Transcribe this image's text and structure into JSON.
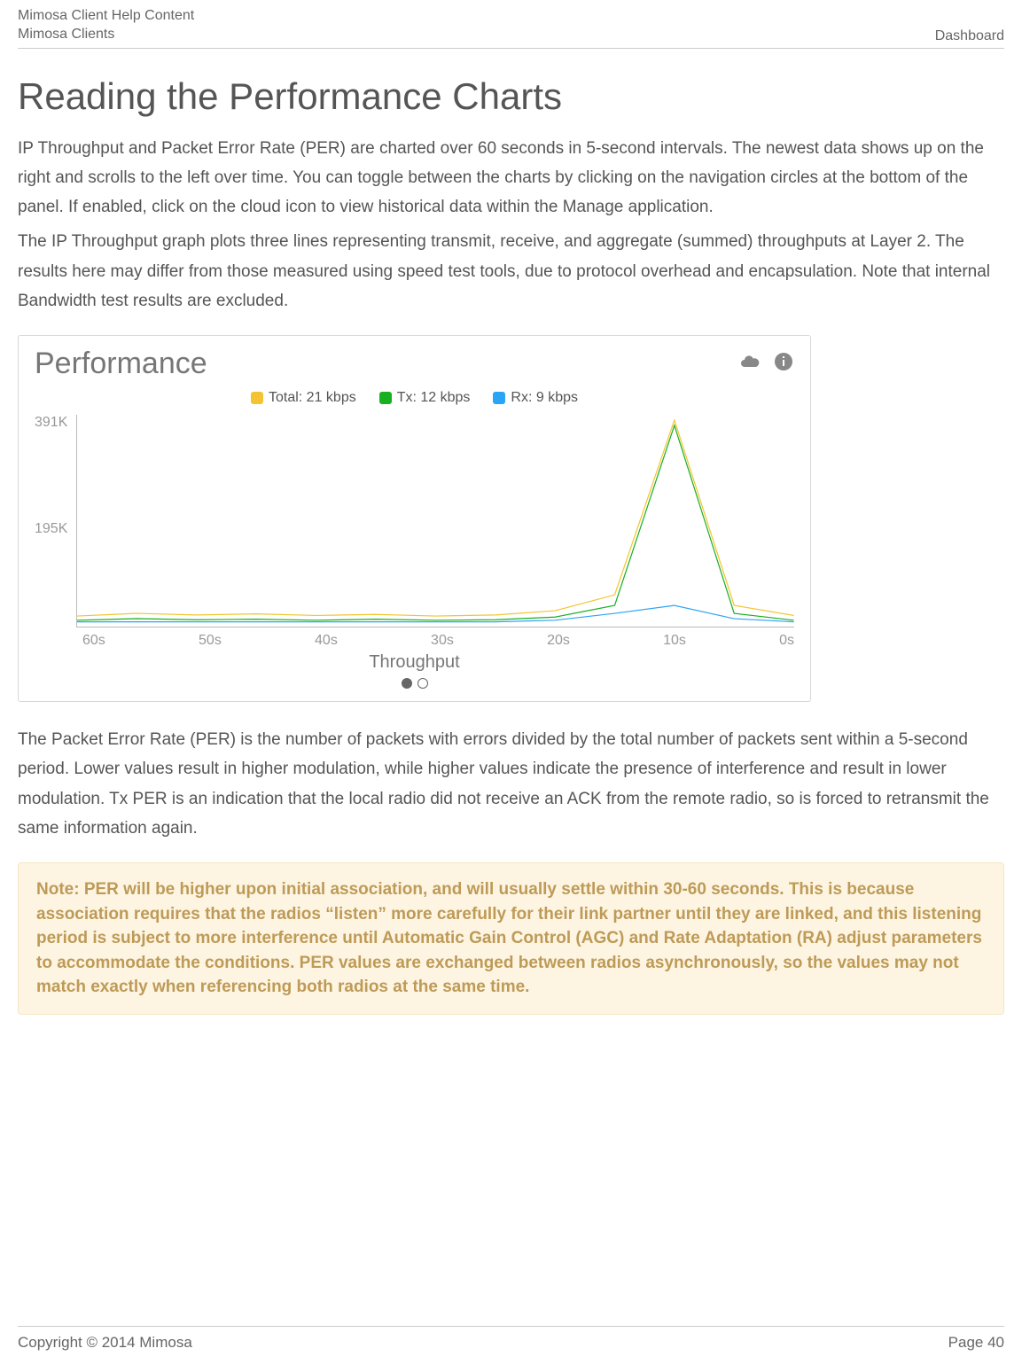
{
  "header": {
    "left_line1": "Mimosa Client Help Content",
    "left_line2": "Mimosa Clients",
    "right": "Dashboard"
  },
  "title": "Reading the Performance Charts",
  "para1": "IP Throughput and Packet Error Rate (PER) are charted over 60 seconds in 5-second intervals. The newest data shows up on the right and scrolls to the left over time. You can toggle between the charts by clicking on the navigation circles at the bottom of the panel. If enabled, click on the cloud icon to view historical data within the Manage application.",
  "para2": "The IP Throughput graph plots three lines representing transmit, receive, and aggregate (summed) throughputs at Layer 2. The results here may differ from those measured using speed test tools, due to protocol overhead and encapsulation. Note that internal Bandwidth test results are excluded.",
  "panel": {
    "title": "Performance",
    "legend": {
      "total": "Total: 21 kbps",
      "tx": "Tx: 12 kbps",
      "rx": "Rx: 9 kbps"
    },
    "colors": {
      "total": "#f4c430",
      "tx": "#17b01e",
      "rx": "#2aa4f4"
    },
    "y_ticks": [
      "391K",
      "195K"
    ],
    "x_ticks": [
      "60s",
      "50s",
      "40s",
      "30s",
      "20s",
      "10s",
      "0s"
    ],
    "x_title": "Throughput"
  },
  "chart_data": {
    "type": "line",
    "title": "Performance",
    "xlabel": "Throughput",
    "ylabel": "",
    "categories": [
      "60s",
      "55s",
      "50s",
      "45s",
      "40s",
      "35s",
      "30s",
      "25s",
      "20s",
      "15s",
      "10s",
      "5s",
      "0s"
    ],
    "ylim": [
      0,
      400000
    ],
    "series": [
      {
        "name": "Total: 21 kbps",
        "color": "#f4c430",
        "values": [
          20000,
          25000,
          22000,
          24000,
          21000,
          23000,
          20000,
          22000,
          30000,
          60000,
          390000,
          40000,
          21000
        ]
      },
      {
        "name": "Tx: 12 kbps",
        "color": "#17b01e",
        "values": [
          12000,
          15000,
          13000,
          14000,
          12000,
          14000,
          12000,
          13000,
          18000,
          40000,
          380000,
          25000,
          12000
        ]
      },
      {
        "name": "Rx: 9 kbps",
        "color": "#2aa4f4",
        "values": [
          9000,
          9000,
          9000,
          9000,
          9000,
          9000,
          9000,
          9000,
          12000,
          25000,
          40000,
          15000,
          9000
        ]
      }
    ]
  },
  "para3": "The Packet Error Rate (PER) is the number of packets with errors divided by the total number of packets sent within a 5-second period. Lower values result in higher modulation, while higher values indicate the presence of interference and result in lower modulation.  Tx PER is an indication that the local radio did not receive an ACK from the remote radio, so is forced to retransmit the same information again.",
  "note": "Note: PER will be higher upon initial association, and will usually settle within 30-60 seconds. This is because association requires that the radios “listen” more carefully for their link partner until they are linked, and this listening period is subject to more interference until Automatic Gain Control (AGC) and Rate Adaptation (RA) adjust parameters to accommodate the conditions. PER values are exchanged between radios asynchronously, so the values may not match exactly when referencing both radios at the same time.",
  "footer": {
    "left": "Copyright © 2014 Mimosa",
    "right": "Page 40"
  }
}
